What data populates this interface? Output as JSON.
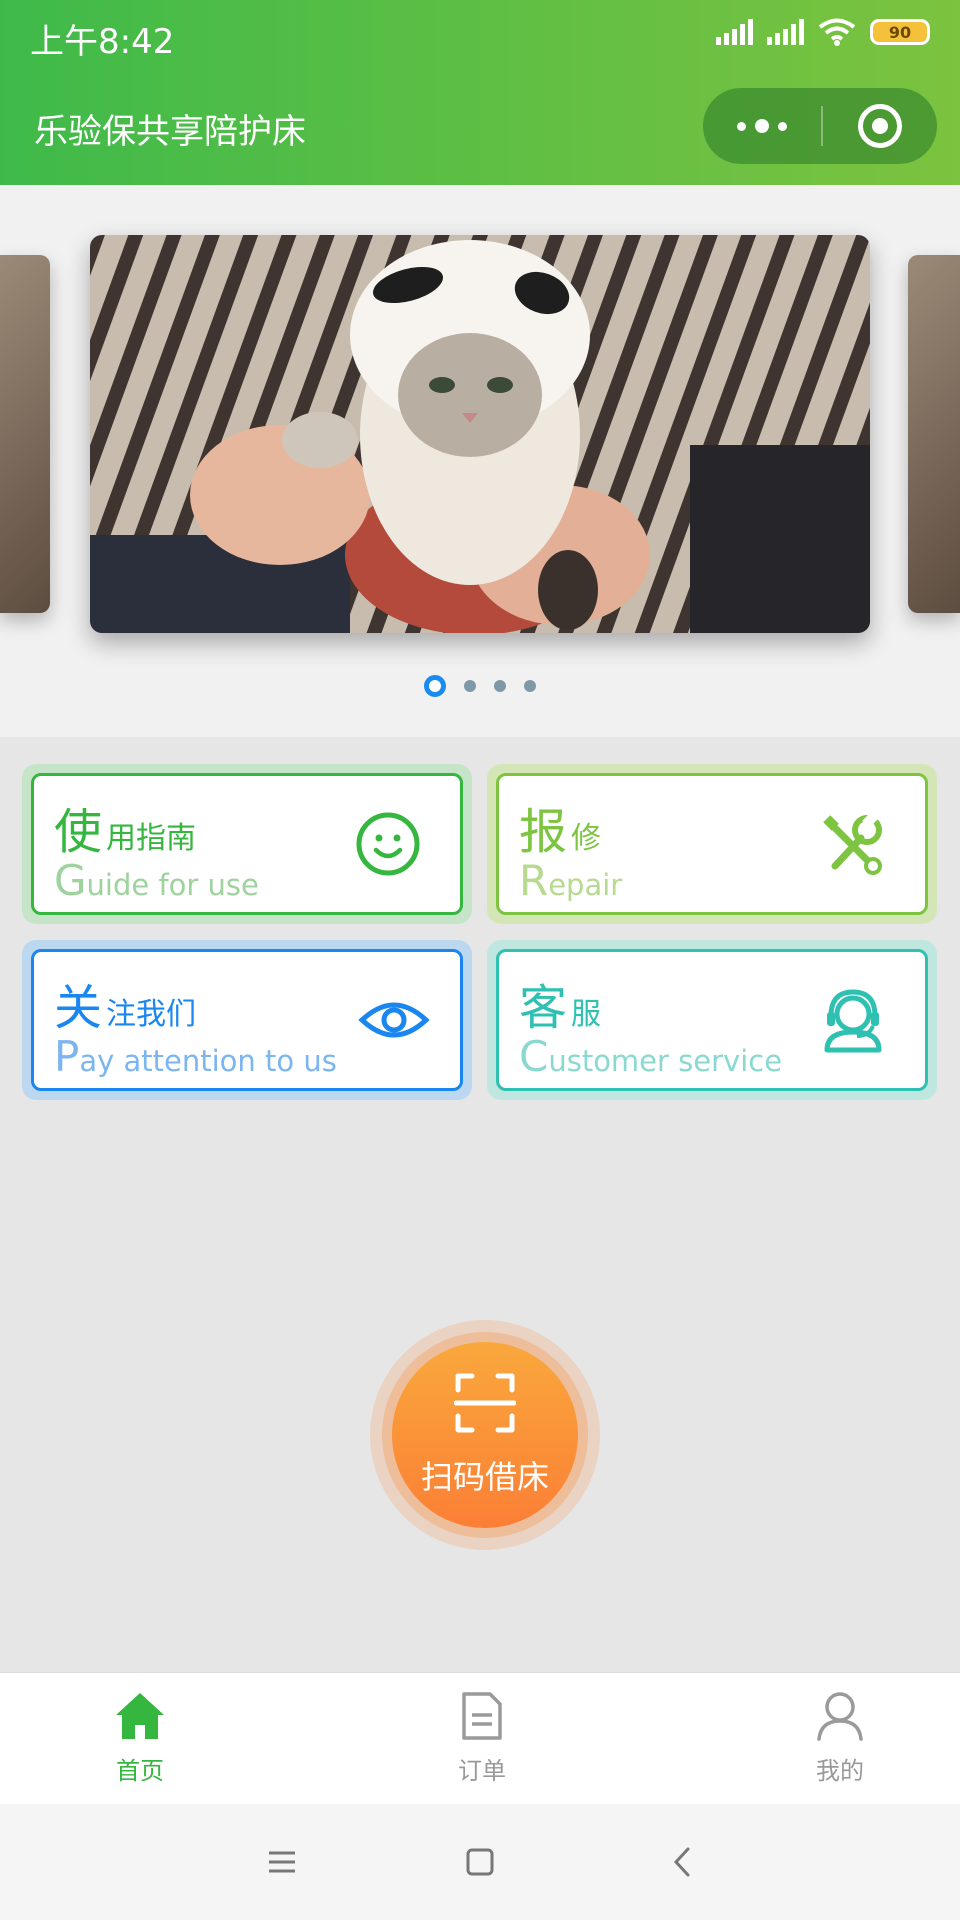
{
  "status_bar": {
    "time": "上午8:42",
    "battery": "90"
  },
  "header": {
    "title": "乐验保共享陪护床"
  },
  "banner": {
    "slide_count": 4,
    "active_index": 0
  },
  "cards": {
    "guide": {
      "cn_first": "使",
      "cn_rest": "用指南",
      "en_first": "G",
      "en_rest": "uide for use",
      "icon": "smile-icon"
    },
    "repair": {
      "cn_first": "报",
      "cn_rest": "修",
      "en_first": "R",
      "en_rest": "epair",
      "icon": "tools-icon"
    },
    "follow": {
      "cn_first": "关",
      "cn_rest": "注我们",
      "en_first": "P",
      "en_rest": "ay attention to us",
      "icon": "eye-icon"
    },
    "service": {
      "cn_first": "客",
      "cn_rest": "服",
      "en_first": "C",
      "en_rest": "ustomer service",
      "icon": "headset-icon"
    }
  },
  "scan": {
    "label": "扫码借床",
    "icon": "scan-icon"
  },
  "tabbar": {
    "home": "首页",
    "orders": "订单",
    "mine": "我的"
  },
  "colors": {
    "header_start": "#3fba4a",
    "header_end": "#7cc33f",
    "guide": "#35b63e",
    "repair": "#7dc441",
    "follow": "#1a86f0",
    "service": "#2ec0b0",
    "scan": "#fb8f38"
  }
}
